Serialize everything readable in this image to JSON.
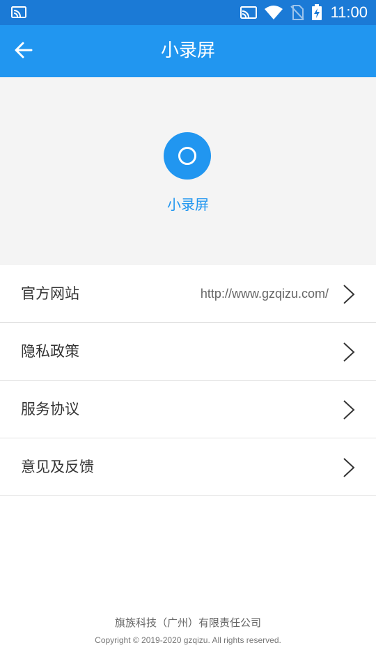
{
  "status_bar": {
    "time": "11:00",
    "icons": [
      "cast-icon",
      "cast-icon",
      "wifi-icon",
      "no-sim-icon",
      "battery-charging-icon"
    ]
  },
  "app_bar": {
    "title": "小录屏",
    "back_icon": "arrow-left-icon"
  },
  "hero": {
    "app_name": "小录屏",
    "logo_icon": "record-circle-icon"
  },
  "menu": {
    "items": [
      {
        "label": "官方网站",
        "value": "http://www.gzqizu.com/"
      },
      {
        "label": "隐私政策",
        "value": ""
      },
      {
        "label": "服务协议",
        "value": ""
      },
      {
        "label": "意见及反馈",
        "value": ""
      }
    ]
  },
  "footer": {
    "company": "旗族科技（广州）有限责任公司",
    "copyright": "Copyright © 2019-2020 gzqizu. All rights reserved."
  },
  "colors": {
    "status_bar": "#1b7ad6",
    "primary": "#2196f0",
    "hero_bg": "#f4f4f4",
    "divider": "#e2e2e2"
  }
}
